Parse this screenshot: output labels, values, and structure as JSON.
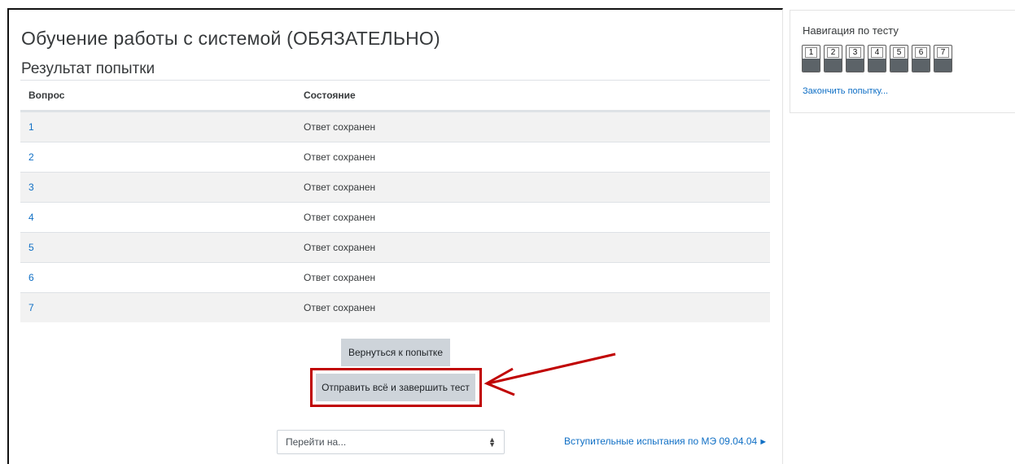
{
  "header": {
    "course_title": "Обучение работы с системой (ОБЯЗАТЕЛЬНО)",
    "page_subtitle": "Результат попытки"
  },
  "table": {
    "columns": [
      "Вопрос",
      "Состояние"
    ],
    "rows": [
      {
        "question": "1",
        "status": "Ответ сохранен"
      },
      {
        "question": "2",
        "status": "Ответ сохранен"
      },
      {
        "question": "3",
        "status": "Ответ сохранен"
      },
      {
        "question": "4",
        "status": "Ответ сохранен"
      },
      {
        "question": "5",
        "status": "Ответ сохранен"
      },
      {
        "question": "6",
        "status": "Ответ сохранен"
      },
      {
        "question": "7",
        "status": "Ответ сохранен"
      }
    ]
  },
  "actions": {
    "return_label": "Вернуться к попытке",
    "submit_label": "Отправить всё и завершить тест"
  },
  "footer": {
    "jump_placeholder": "Перейти на...",
    "next_link": "Вступительные испытания по МЭ 09.04.04"
  },
  "navigation": {
    "title": "Навигация по тесту",
    "questions": [
      "1",
      "2",
      "3",
      "4",
      "5",
      "6",
      "7"
    ],
    "finish_link": "Закончить попытку..."
  },
  "colors": {
    "link": "#0f6fc5",
    "highlight": "#c00000",
    "button_bg": "#ced4da"
  }
}
